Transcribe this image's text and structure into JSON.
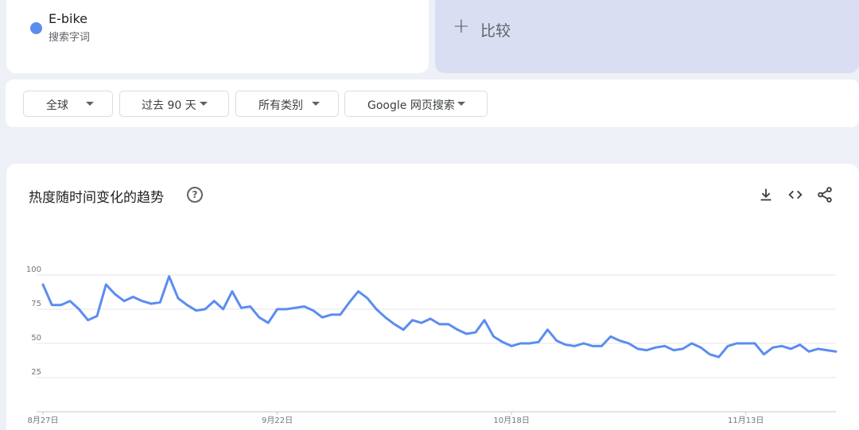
{
  "term": {
    "name": "E-bike",
    "type": "搜索字词",
    "color": "#5b8def"
  },
  "compare": {
    "plus": "+",
    "label": "比较"
  },
  "filters": {
    "region": "全球",
    "time": "过去 90 天",
    "category": "所有类别",
    "source": "Google 网页搜索"
  },
  "chart": {
    "title": "热度随时间变化的趋势",
    "help": "?",
    "icons": [
      "download-icon",
      "embed-icon",
      "share-icon"
    ]
  },
  "chart_data": {
    "type": "line",
    "title": "",
    "xlabel": "",
    "ylabel": "",
    "ylim": [
      0,
      100
    ],
    "yticks": [
      25,
      50,
      75,
      100
    ],
    "grid": true,
    "x_tick_labels": [
      "8月27日",
      "9月22日",
      "10月18日",
      "11月13日"
    ],
    "x_tick_index": [
      0,
      26,
      52,
      78
    ],
    "series": [
      {
        "color": "#5b8def",
        "values": [
          93,
          78,
          78,
          81,
          75,
          67,
          70,
          93,
          86,
          81,
          84,
          81,
          79,
          80,
          99,
          83,
          78,
          74,
          75,
          81,
          75,
          88,
          76,
          77,
          69,
          65,
          75,
          75,
          76,
          77,
          74,
          69,
          71,
          71,
          80,
          88,
          83,
          75,
          69,
          64,
          60,
          67,
          65,
          68,
          64,
          64,
          60,
          57,
          58,
          67,
          55,
          51,
          48,
          50,
          50,
          51,
          60,
          52,
          49,
          48,
          50,
          48,
          48,
          55,
          52,
          50,
          46,
          45,
          47,
          48,
          45,
          46,
          50,
          47,
          42,
          40,
          48,
          50,
          50,
          50,
          42,
          47,
          48,
          46,
          49,
          44,
          46,
          45,
          44
        ]
      }
    ]
  }
}
